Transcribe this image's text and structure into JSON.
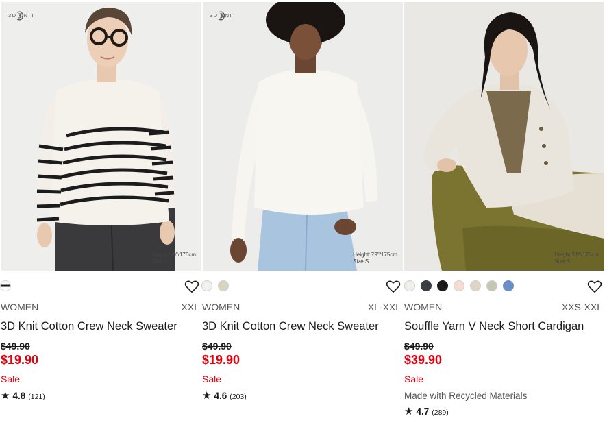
{
  "products": [
    {
      "badge_text": "3D KNIT",
      "model_info": [
        "Height:5'9\"/176cm",
        "Size:S"
      ],
      "swatches": [
        "#1d1d1d"
      ],
      "gender": "WOMEN",
      "sizes": "XXL",
      "name": "3D Knit Cotton Crew Neck Sweater",
      "original_price": "$49.90",
      "sale_price": "$19.90",
      "flag": "Sale",
      "note": "",
      "rating": "4.8",
      "review_count": "(121)"
    },
    {
      "badge_text": "3D KNIT",
      "model_info": [
        "Height:5'9\"/175cm",
        "Size:S"
      ],
      "swatches": [
        "#f2f1ee",
        "#d9d4c0"
      ],
      "gender": "WOMEN",
      "sizes": "XL-XXL",
      "name": "3D Knit Cotton Crew Neck Sweater",
      "original_price": "$49.90",
      "sale_price": "$19.90",
      "flag": "Sale",
      "note": "",
      "rating": "4.6",
      "review_count": "(203)"
    },
    {
      "badge_text": "",
      "model_info": [
        "Height:5'9\"/176cm",
        "Size:S"
      ],
      "swatches": [
        "#f1efea",
        "#3a3d43",
        "#1c1c1c",
        "#f4ddd0",
        "#ddd5c6",
        "#c2c8b4",
        "#6b8fc4"
      ],
      "gender": "WOMEN",
      "sizes": "XXS-XXL",
      "name": "Souffle Yarn V Neck Short Cardigan",
      "original_price": "$49.90",
      "sale_price": "$39.90",
      "flag": "Sale",
      "note": "Made with Recycled Materials",
      "rating": "4.7",
      "review_count": "(289)"
    }
  ],
  "icons": {
    "favorite": "heart-outline-icon",
    "rating": "star-icon",
    "brand_badge": "3d-knit-logo-icon"
  }
}
